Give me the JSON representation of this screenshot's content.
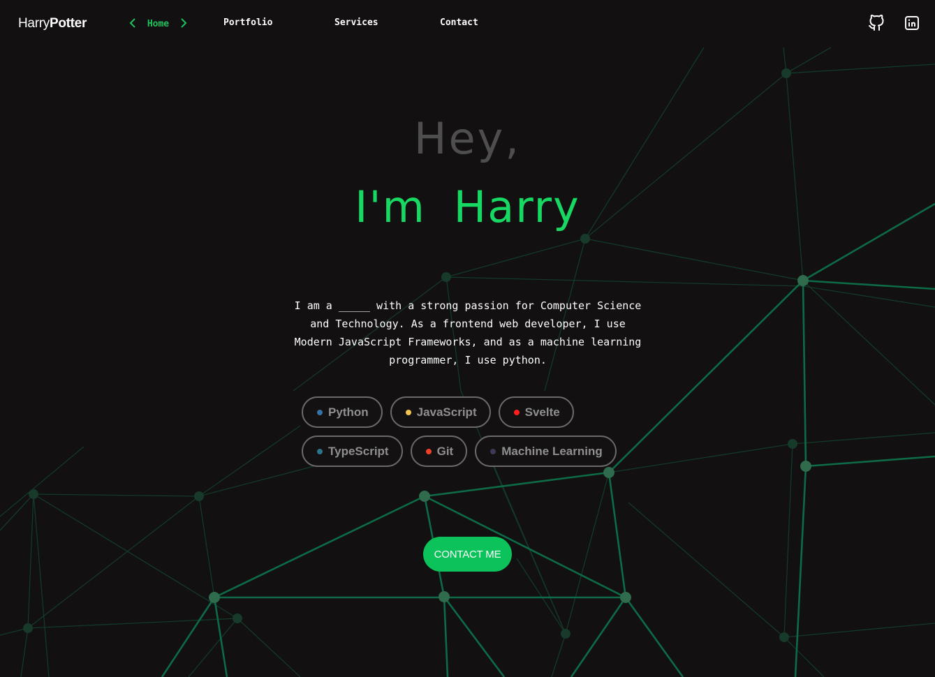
{
  "header": {
    "logo_light": "Harry",
    "logo_bold": "Potter",
    "nav": [
      {
        "label": "Home",
        "active": true
      },
      {
        "label": "Portfolio",
        "active": false
      },
      {
        "label": "Services",
        "active": false
      },
      {
        "label": "Contact",
        "active": false
      }
    ],
    "icons": [
      "github-icon",
      "linkedin-icon"
    ]
  },
  "hero": {
    "greeting": "Hey,",
    "name": "I'm Harry",
    "description": "I am a _____ with a strong passion for Computer Science and Technology. As a frontend web developer, I use Modern JavaScript Frameworks, and as a machine learning programmer, I use python.",
    "tags": [
      {
        "label": "Python",
        "color": "#3572a5"
      },
      {
        "label": "JavaScript",
        "color": "#f1c64f"
      },
      {
        "label": "Svelte",
        "color": "#ff1f1f"
      },
      {
        "label": "TypeScript",
        "color": "#2b7489"
      },
      {
        "label": "Git",
        "color": "#f1402a"
      },
      {
        "label": "Machine Learning",
        "color": "#3c3a55"
      }
    ],
    "cta_label": "CONTACT ME"
  },
  "colors": {
    "background": "#121010",
    "accent": "#17d862",
    "button": "#0bc35a",
    "network_line": "#0d6b47",
    "network_node": "#2f6b4c"
  }
}
